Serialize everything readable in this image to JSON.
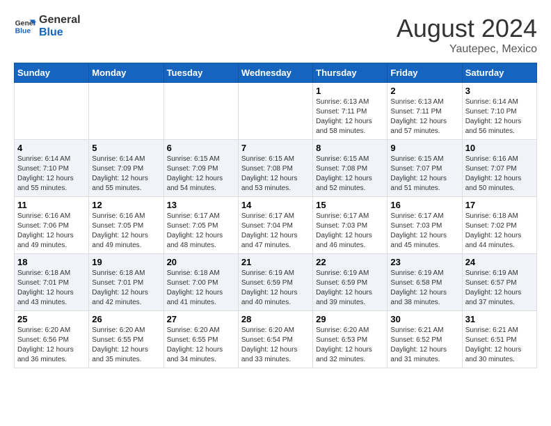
{
  "header": {
    "logo_line1": "General",
    "logo_line2": "Blue",
    "main_title": "August 2024",
    "subtitle": "Yautepec, Mexico"
  },
  "days_of_week": [
    "Sunday",
    "Monday",
    "Tuesday",
    "Wednesday",
    "Thursday",
    "Friday",
    "Saturday"
  ],
  "weeks": [
    [
      {
        "day": "",
        "info": ""
      },
      {
        "day": "",
        "info": ""
      },
      {
        "day": "",
        "info": ""
      },
      {
        "day": "",
        "info": ""
      },
      {
        "day": "1",
        "info": "Sunrise: 6:13 AM\nSunset: 7:11 PM\nDaylight: 12 hours\nand 58 minutes."
      },
      {
        "day": "2",
        "info": "Sunrise: 6:13 AM\nSunset: 7:11 PM\nDaylight: 12 hours\nand 57 minutes."
      },
      {
        "day": "3",
        "info": "Sunrise: 6:14 AM\nSunset: 7:10 PM\nDaylight: 12 hours\nand 56 minutes."
      }
    ],
    [
      {
        "day": "4",
        "info": "Sunrise: 6:14 AM\nSunset: 7:10 PM\nDaylight: 12 hours\nand 55 minutes."
      },
      {
        "day": "5",
        "info": "Sunrise: 6:14 AM\nSunset: 7:09 PM\nDaylight: 12 hours\nand 55 minutes."
      },
      {
        "day": "6",
        "info": "Sunrise: 6:15 AM\nSunset: 7:09 PM\nDaylight: 12 hours\nand 54 minutes."
      },
      {
        "day": "7",
        "info": "Sunrise: 6:15 AM\nSunset: 7:08 PM\nDaylight: 12 hours\nand 53 minutes."
      },
      {
        "day": "8",
        "info": "Sunrise: 6:15 AM\nSunset: 7:08 PM\nDaylight: 12 hours\nand 52 minutes."
      },
      {
        "day": "9",
        "info": "Sunrise: 6:15 AM\nSunset: 7:07 PM\nDaylight: 12 hours\nand 51 minutes."
      },
      {
        "day": "10",
        "info": "Sunrise: 6:16 AM\nSunset: 7:07 PM\nDaylight: 12 hours\nand 50 minutes."
      }
    ],
    [
      {
        "day": "11",
        "info": "Sunrise: 6:16 AM\nSunset: 7:06 PM\nDaylight: 12 hours\nand 49 minutes."
      },
      {
        "day": "12",
        "info": "Sunrise: 6:16 AM\nSunset: 7:05 PM\nDaylight: 12 hours\nand 49 minutes."
      },
      {
        "day": "13",
        "info": "Sunrise: 6:17 AM\nSunset: 7:05 PM\nDaylight: 12 hours\nand 48 minutes."
      },
      {
        "day": "14",
        "info": "Sunrise: 6:17 AM\nSunset: 7:04 PM\nDaylight: 12 hours\nand 47 minutes."
      },
      {
        "day": "15",
        "info": "Sunrise: 6:17 AM\nSunset: 7:03 PM\nDaylight: 12 hours\nand 46 minutes."
      },
      {
        "day": "16",
        "info": "Sunrise: 6:17 AM\nSunset: 7:03 PM\nDaylight: 12 hours\nand 45 minutes."
      },
      {
        "day": "17",
        "info": "Sunrise: 6:18 AM\nSunset: 7:02 PM\nDaylight: 12 hours\nand 44 minutes."
      }
    ],
    [
      {
        "day": "18",
        "info": "Sunrise: 6:18 AM\nSunset: 7:01 PM\nDaylight: 12 hours\nand 43 minutes."
      },
      {
        "day": "19",
        "info": "Sunrise: 6:18 AM\nSunset: 7:01 PM\nDaylight: 12 hours\nand 42 minutes."
      },
      {
        "day": "20",
        "info": "Sunrise: 6:18 AM\nSunset: 7:00 PM\nDaylight: 12 hours\nand 41 minutes."
      },
      {
        "day": "21",
        "info": "Sunrise: 6:19 AM\nSunset: 6:59 PM\nDaylight: 12 hours\nand 40 minutes."
      },
      {
        "day": "22",
        "info": "Sunrise: 6:19 AM\nSunset: 6:59 PM\nDaylight: 12 hours\nand 39 minutes."
      },
      {
        "day": "23",
        "info": "Sunrise: 6:19 AM\nSunset: 6:58 PM\nDaylight: 12 hours\nand 38 minutes."
      },
      {
        "day": "24",
        "info": "Sunrise: 6:19 AM\nSunset: 6:57 PM\nDaylight: 12 hours\nand 37 minutes."
      }
    ],
    [
      {
        "day": "25",
        "info": "Sunrise: 6:20 AM\nSunset: 6:56 PM\nDaylight: 12 hours\nand 36 minutes."
      },
      {
        "day": "26",
        "info": "Sunrise: 6:20 AM\nSunset: 6:55 PM\nDaylight: 12 hours\nand 35 minutes."
      },
      {
        "day": "27",
        "info": "Sunrise: 6:20 AM\nSunset: 6:55 PM\nDaylight: 12 hours\nand 34 minutes."
      },
      {
        "day": "28",
        "info": "Sunrise: 6:20 AM\nSunset: 6:54 PM\nDaylight: 12 hours\nand 33 minutes."
      },
      {
        "day": "29",
        "info": "Sunrise: 6:20 AM\nSunset: 6:53 PM\nDaylight: 12 hours\nand 32 minutes."
      },
      {
        "day": "30",
        "info": "Sunrise: 6:21 AM\nSunset: 6:52 PM\nDaylight: 12 hours\nand 31 minutes."
      },
      {
        "day": "31",
        "info": "Sunrise: 6:21 AM\nSunset: 6:51 PM\nDaylight: 12 hours\nand 30 minutes."
      }
    ]
  ]
}
